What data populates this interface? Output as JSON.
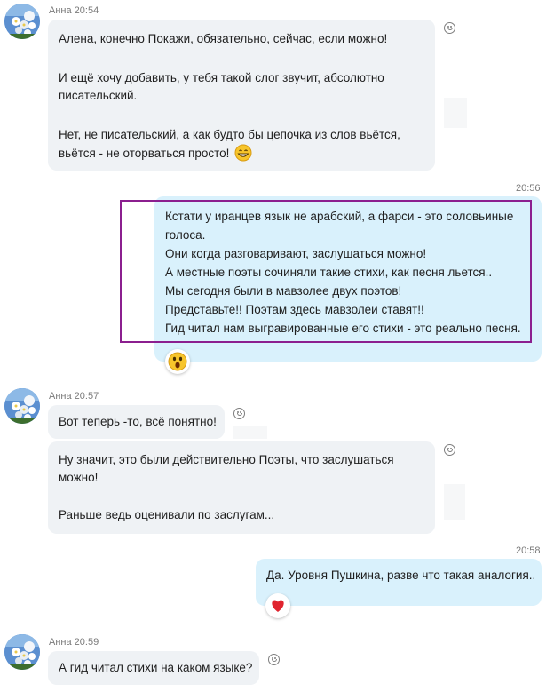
{
  "colors": {
    "incoming_bubble": "#eff2f5",
    "outgoing_bubble": "#d9f1fc",
    "selection_border": "#8b1f8f",
    "heart": "#e0242f"
  },
  "messages": [
    {
      "sender": "Анна",
      "time": "20:54",
      "lines": [
        "Алена, конечно Покажи, обязательно, сейчас, если можно!",
        "",
        "И ещё хочу добавить, у тебя такой слог звучит, абсолютно",
        "писательский.",
        "",
        "Нет, не писательский,  а как будто бы цепочка из слов вьётся,",
        "вьётся - не оторваться просто!"
      ],
      "emoji": "grin-emoji"
    },
    {
      "outgoing": true,
      "time": "20:56",
      "lines": [
        "Кстати у иранцев язык не арабский, а фарси - это соловьиные",
        "голоса.",
        "Они когда разговаривают, заслушаться можно!",
        "А местные поэты сочиняли такие стихи, как песня льется..",
        "Мы сегодня были в мавзолее двух поэтов!",
        "Представьте!! Поэтам здесь мавзолеи ставят!!",
        "Гид читал нам выгравированные его стихи - это реально песня."
      ],
      "reaction": "surprised-emoji"
    },
    {
      "sender": "Анна",
      "time": "20:57",
      "lines": [
        "Вот теперь -то, всё понятно!"
      ]
    },
    {
      "lines": [
        "Ну значит, это были действительно Поэты, что заслушаться",
        "можно!",
        "",
        "Раньше ведь оценивали по заслугам..."
      ]
    },
    {
      "outgoing": true,
      "time": "20:58",
      "lines": [
        "Да. Уровня Пушкина, разве что такая аналогия.."
      ],
      "reaction": "heart-emoji"
    },
    {
      "sender": "Анна",
      "time": "20:59",
      "lines": [
        "А гид читал стихи на каком языке?"
      ]
    }
  ]
}
